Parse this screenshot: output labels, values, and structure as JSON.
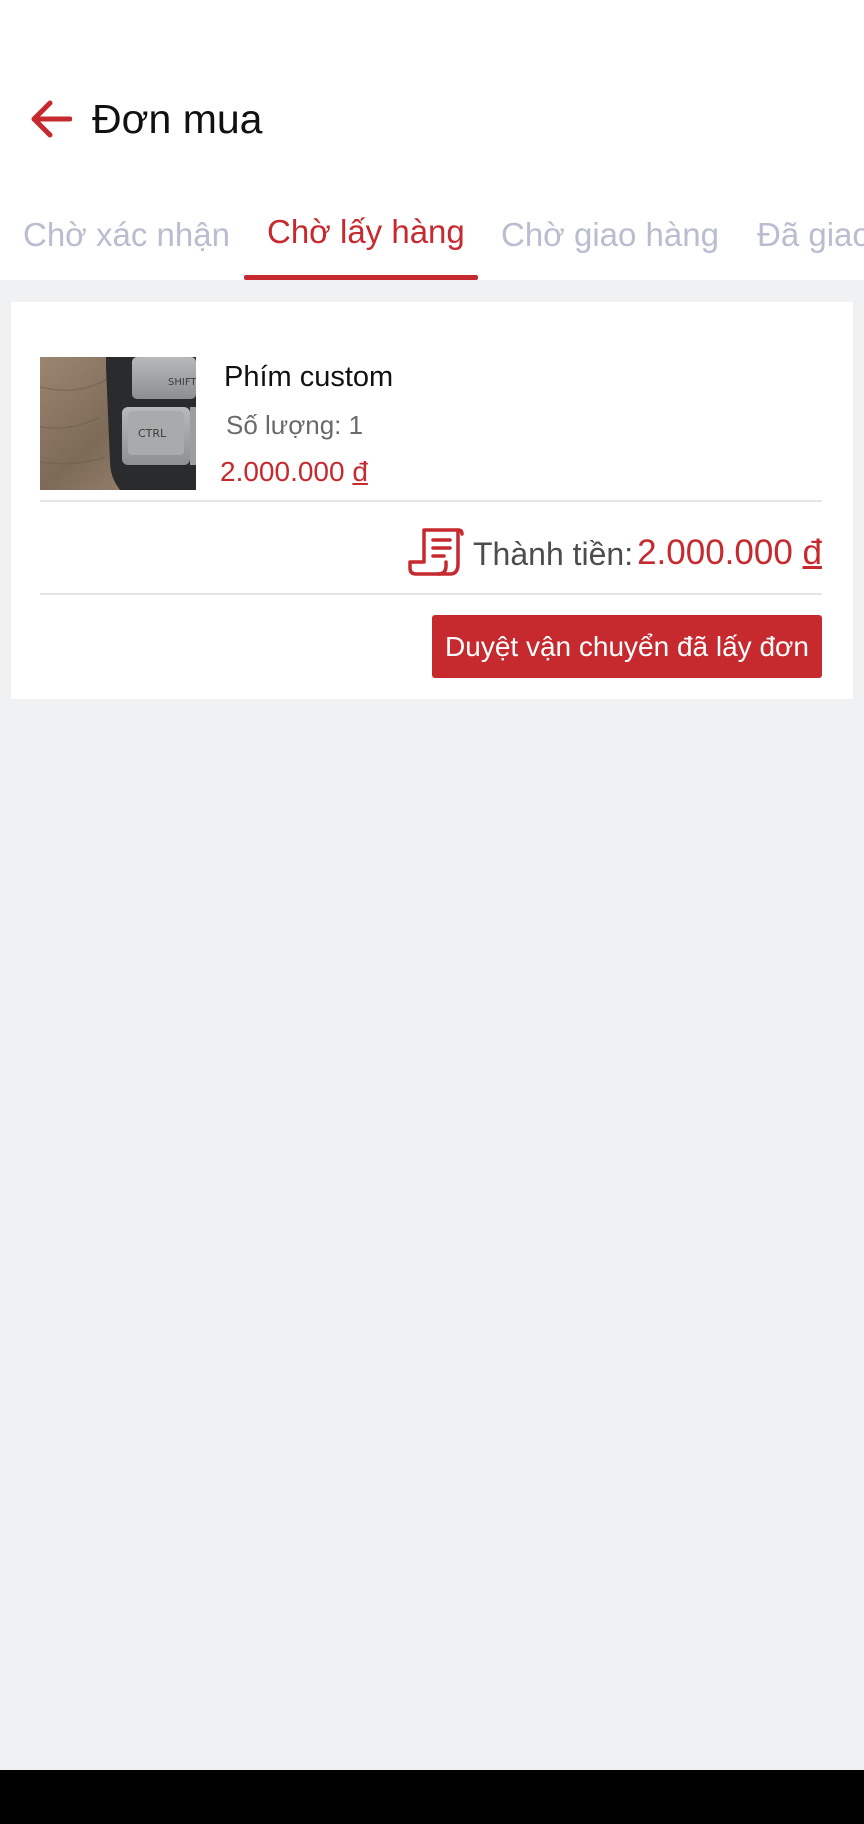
{
  "header": {
    "title": "Đơn mua",
    "back_icon": "arrow-left-icon"
  },
  "tabs": [
    {
      "label": "Chờ xác nhận",
      "active": false
    },
    {
      "label": "Chờ lấy hàng",
      "active": true
    },
    {
      "label": "Chờ giao hàng",
      "active": false
    },
    {
      "label": "Đã giao",
      "active": false
    }
  ],
  "order": {
    "product_name": "Phím custom",
    "quantity_text": "Số lượng: 1",
    "price": "2.000.000",
    "currency": "đ",
    "total_label": "Thành tiền:",
    "total_value": "2.000.000",
    "total_currency": "đ",
    "action_label": "Duyệt vận chuyển đã lấy đơn",
    "image_key_labels": [
      "SHIFT",
      "CTRL"
    ]
  },
  "colors": {
    "accent": "#c62a2f",
    "tab_inactive": "#b8bdd0",
    "background": "#f0f1f3"
  }
}
